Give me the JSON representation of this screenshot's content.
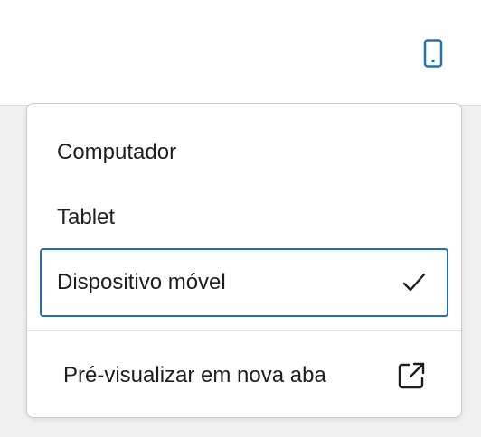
{
  "toolbar": {
    "device_icon": "mobile-phone-icon",
    "accent_color": "#2271b1"
  },
  "menu": {
    "items": [
      {
        "label": "Computador",
        "selected": false
      },
      {
        "label": "Tablet",
        "selected": false
      },
      {
        "label": "Dispositivo móvel",
        "selected": true,
        "indicator_icon": "checkmark-icon"
      }
    ],
    "preview": {
      "label": "Pré-visualizar em nova aba",
      "icon": "external-link-icon"
    }
  }
}
